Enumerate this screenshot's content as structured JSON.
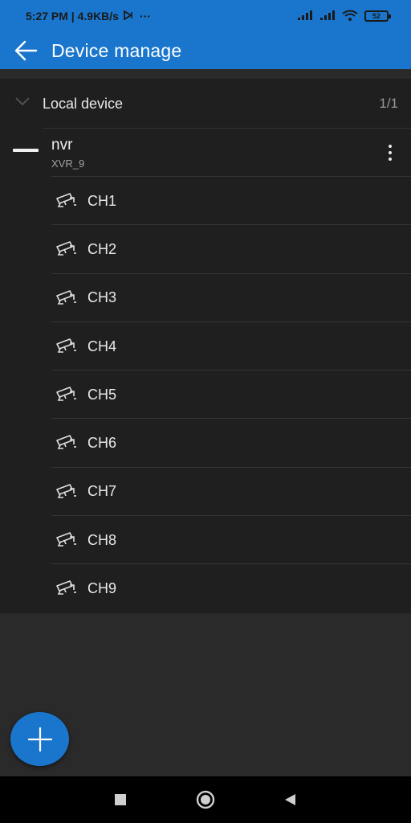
{
  "status_bar": {
    "time_info": "5:27 PM | 4.9KB/s",
    "dots": "···",
    "battery": "52"
  },
  "app_bar": {
    "title": "Device manage"
  },
  "group": {
    "label": "Local device",
    "count": "1/1"
  },
  "device": {
    "name": "nvr",
    "subtitle": "XVR_9"
  },
  "channels": [
    "CH1",
    "CH2",
    "CH3",
    "CH4",
    "CH5",
    "CH6",
    "CH7",
    "CH8",
    "CH9"
  ],
  "colors": {
    "accent": "#1976cc",
    "panel": "#1f1f1f",
    "background": "#2a2a2a"
  }
}
